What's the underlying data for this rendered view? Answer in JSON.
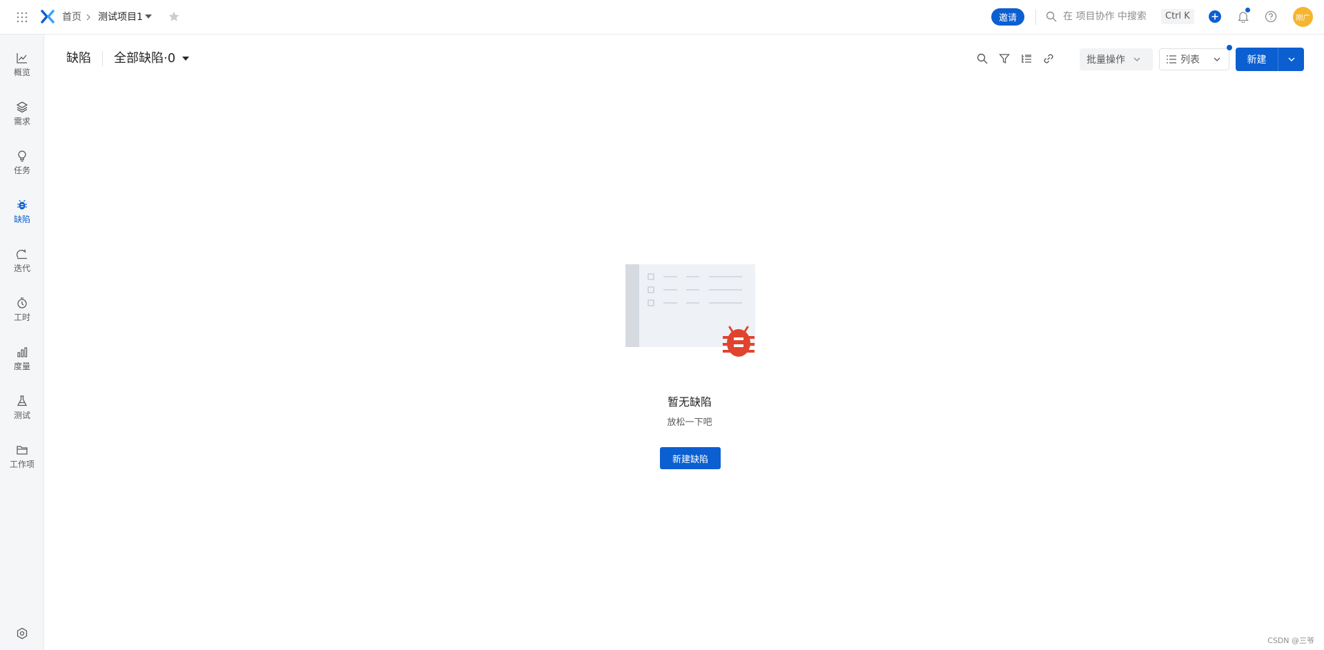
{
  "topbar": {
    "breadcrumb_home": "首页",
    "project_name": "测试项目1",
    "invite_label": "邀请",
    "search_placeholder": "在 项目协作 中搜索",
    "shortcut": "Ctrl K",
    "avatar_text": "刚广"
  },
  "sidebar": {
    "items": [
      {
        "label": "概览",
        "icon": "line-chart-icon"
      },
      {
        "label": "需求",
        "icon": "layers-icon"
      },
      {
        "label": "任务",
        "icon": "lightbulb-icon"
      },
      {
        "label": "缺陷",
        "icon": "bug-icon",
        "active": true
      },
      {
        "label": "迭代",
        "icon": "iteration-icon"
      },
      {
        "label": "工时",
        "icon": "stopwatch-icon"
      },
      {
        "label": "度量",
        "icon": "bar-chart-icon"
      },
      {
        "label": "测试",
        "icon": "flask-icon"
      },
      {
        "label": "工作项",
        "icon": "folder-icon"
      }
    ],
    "settings_icon": "settings-icon"
  },
  "header": {
    "title": "缺陷",
    "view_name": "全部缺陷·0",
    "batch_label": "批量操作",
    "view_mode_label": "列表",
    "new_label": "新建"
  },
  "empty_state": {
    "title": "暂无缺陷",
    "subtitle": "放松一下吧",
    "button_label": "新建缺陷"
  },
  "watermark": "CSDN @三爷",
  "colors": {
    "accent": "#0b5fd1",
    "bug_red": "#e0442f",
    "avatar_bg": "#f5b52e"
  }
}
